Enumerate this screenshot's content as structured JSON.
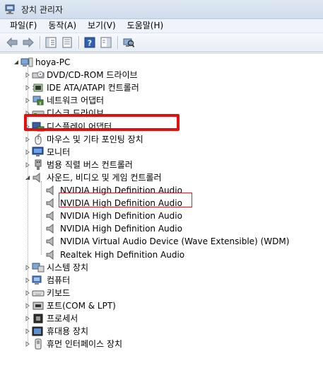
{
  "window": {
    "title": "장치 관리자"
  },
  "menu": [
    {
      "label": "파일(F)"
    },
    {
      "label": "동작(A)"
    },
    {
      "label": "보기(V)"
    },
    {
      "label": "도움말(H)"
    }
  ],
  "tree": {
    "root": "hoya-PC",
    "categories": [
      {
        "label": "DVD/CD-ROM 드라이브",
        "icon": "dvd-drive-icon"
      },
      {
        "label": "IDE ATA/ATAPI 컨트롤러",
        "icon": "ide-controller-icon"
      },
      {
        "label": "네트워크 어댑터",
        "icon": "network-adapter-icon"
      },
      {
        "label": "디스크 드라이브",
        "icon": "disk-drive-icon"
      },
      {
        "label": "디스플레이 어댑터",
        "icon": "display-adapter-icon"
      },
      {
        "label": "마우스 및 기타 포인팅 장치",
        "icon": "mouse-icon"
      },
      {
        "label": "모니터",
        "icon": "monitor-icon"
      },
      {
        "label": "범용 직렬 버스 컨트롤러",
        "icon": "usb-controller-icon"
      },
      {
        "label": "사운드, 비디오 및 게임 컨트롤러",
        "icon": "speaker-icon"
      }
    ],
    "sound_devices": [
      {
        "label": "NVIDIA High Definition Audio"
      },
      {
        "label": "NVIDIA High Definition Audio"
      },
      {
        "label": "NVIDIA High Definition Audio"
      },
      {
        "label": "NVIDIA High Definition Audio"
      },
      {
        "label": "NVIDIA Virtual Audio Device (Wave Extensible) (WDM)"
      },
      {
        "label": "Realtek High Definition Audio"
      }
    ],
    "categories_after": [
      {
        "label": "시스템 장치",
        "icon": "system-device-icon"
      },
      {
        "label": "컴퓨터",
        "icon": "computer-icon"
      },
      {
        "label": "키보드",
        "icon": "keyboard-icon"
      },
      {
        "label": "포트(COM & LPT)",
        "icon": "port-icon"
      },
      {
        "label": "프로세서",
        "icon": "processor-icon"
      },
      {
        "label": "휴대용 장치",
        "icon": "portable-device-icon"
      },
      {
        "label": "휴먼 인터페이스 장치",
        "icon": "hid-icon"
      }
    ]
  },
  "colors": {
    "highlight_red": "#e01010",
    "titlebar": "#dfe8f3"
  }
}
